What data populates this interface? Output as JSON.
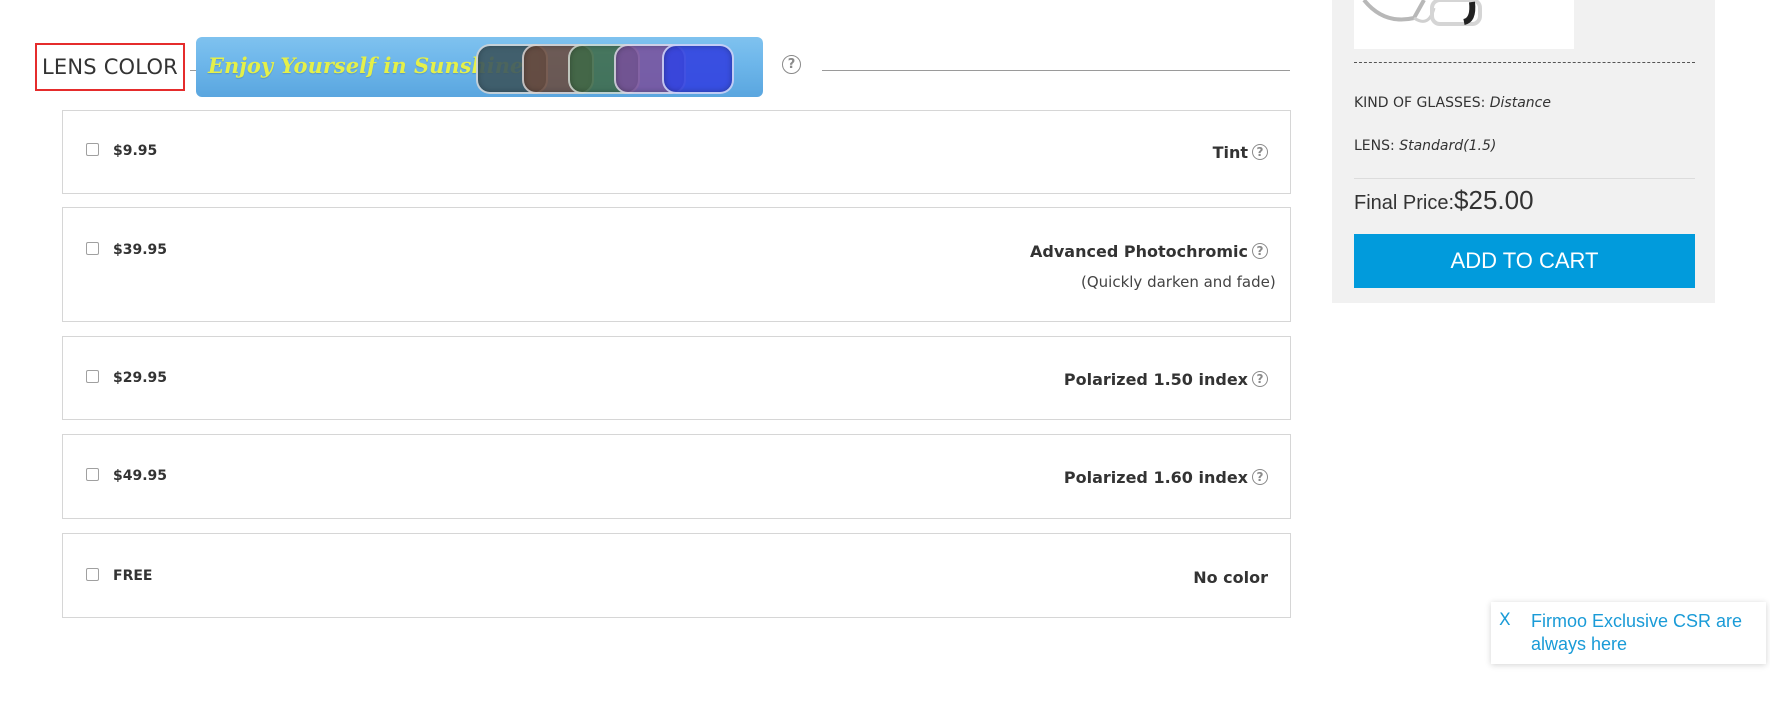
{
  "lens_color": {
    "title": "LENS COLOR",
    "banner_text": "Enjoy Yourself in Sunshine",
    "help_icon": "?",
    "banner_lens_colors": [
      "#3c5660",
      "#6b4a3c",
      "#3e6a46",
      "#7a4f9c",
      "#3344e0"
    ]
  },
  "options": [
    {
      "price": "$9.95",
      "name": "Tint",
      "sub": "",
      "help": "?"
    },
    {
      "price": "$39.95",
      "name": "Advanced Photochromic",
      "sub": "(Quickly darken and fade)",
      "help": "?"
    },
    {
      "price": "$29.95",
      "name": "Polarized 1.50 index",
      "sub": "",
      "help": "?"
    },
    {
      "price": "$49.95",
      "name": "Polarized 1.60 index",
      "sub": "",
      "help": "?"
    },
    {
      "price": "FREE",
      "name": "No color",
      "sub": "",
      "help": ""
    }
  ],
  "summary": {
    "kind_label": "KIND OF GLASSES:",
    "kind_value": "Distance",
    "lens_label": "LENS:",
    "lens_value": "Standard(1.5)",
    "final_price_label": "Final Price:",
    "final_price_value": "$25.00",
    "add_to_cart": "ADD TO CART"
  },
  "csr_popup": {
    "close": "X",
    "text": "Firmoo Exclusive CSR are always here"
  },
  "colors": {
    "accent_blue": "#019bdc",
    "highlight_red": "#e52c2c",
    "link_blue": "#1a9bd7"
  }
}
